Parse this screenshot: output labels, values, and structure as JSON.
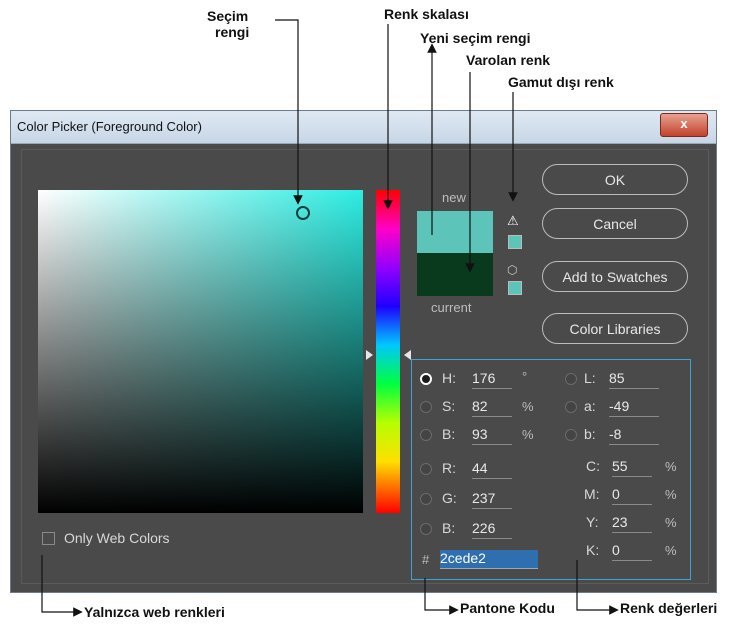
{
  "annotations": {
    "secim_rengi_1": "Seçim",
    "secim_rengi_2": "rengi",
    "renk_skalasi": "Renk skalası",
    "yeni_secim_rengi": "Yeni seçim rengi",
    "varolan_renk": "Varolan renk",
    "gamut_disi_renk": "Gamut dışı renk",
    "yalnizca_web_renkleri": "Yalnızca web renkleri",
    "pantone_kodu": "Pantone Kodu",
    "renk_degerleri": "Renk değerleri"
  },
  "window": {
    "title": "Color Picker (Foreground Color)",
    "close": "x"
  },
  "preview": {
    "new_label": "new",
    "current_label": "current",
    "warning_icon": "⚠",
    "cube_icon": "⬡"
  },
  "buttons": {
    "ok": "OK",
    "cancel": "Cancel",
    "add_to_swatches": "Add to Swatches",
    "color_libraries": "Color Libraries"
  },
  "hsb": {
    "h": {
      "label": "H:",
      "value": "176",
      "unit": "°"
    },
    "s": {
      "label": "S:",
      "value": "82",
      "unit": "%"
    },
    "b": {
      "label": "B:",
      "value": "93",
      "unit": "%"
    }
  },
  "rgb": {
    "r": {
      "label": "R:",
      "value": "44"
    },
    "g": {
      "label": "G:",
      "value": "237"
    },
    "b": {
      "label": "B:",
      "value": "226"
    }
  },
  "lab": {
    "l": {
      "label": "L:",
      "value": "85"
    },
    "a": {
      "label": "a:",
      "value": "-49"
    },
    "b": {
      "label": "b:",
      "value": "-8"
    }
  },
  "cmyk": {
    "c": {
      "label": "C:",
      "value": "55",
      "unit": "%"
    },
    "m": {
      "label": "M:",
      "value": "0",
      "unit": "%"
    },
    "y": {
      "label": "Y:",
      "value": "23",
      "unit": "%"
    },
    "k": {
      "label": "K:",
      "value": "0",
      "unit": "%"
    }
  },
  "hex": {
    "label": "#",
    "value": "2cede2"
  },
  "only_web_colors": "Only Web Colors",
  "colors": {
    "selected": "#2cede2",
    "current": "#0a3a1e",
    "accent": "#3fa3d2"
  }
}
